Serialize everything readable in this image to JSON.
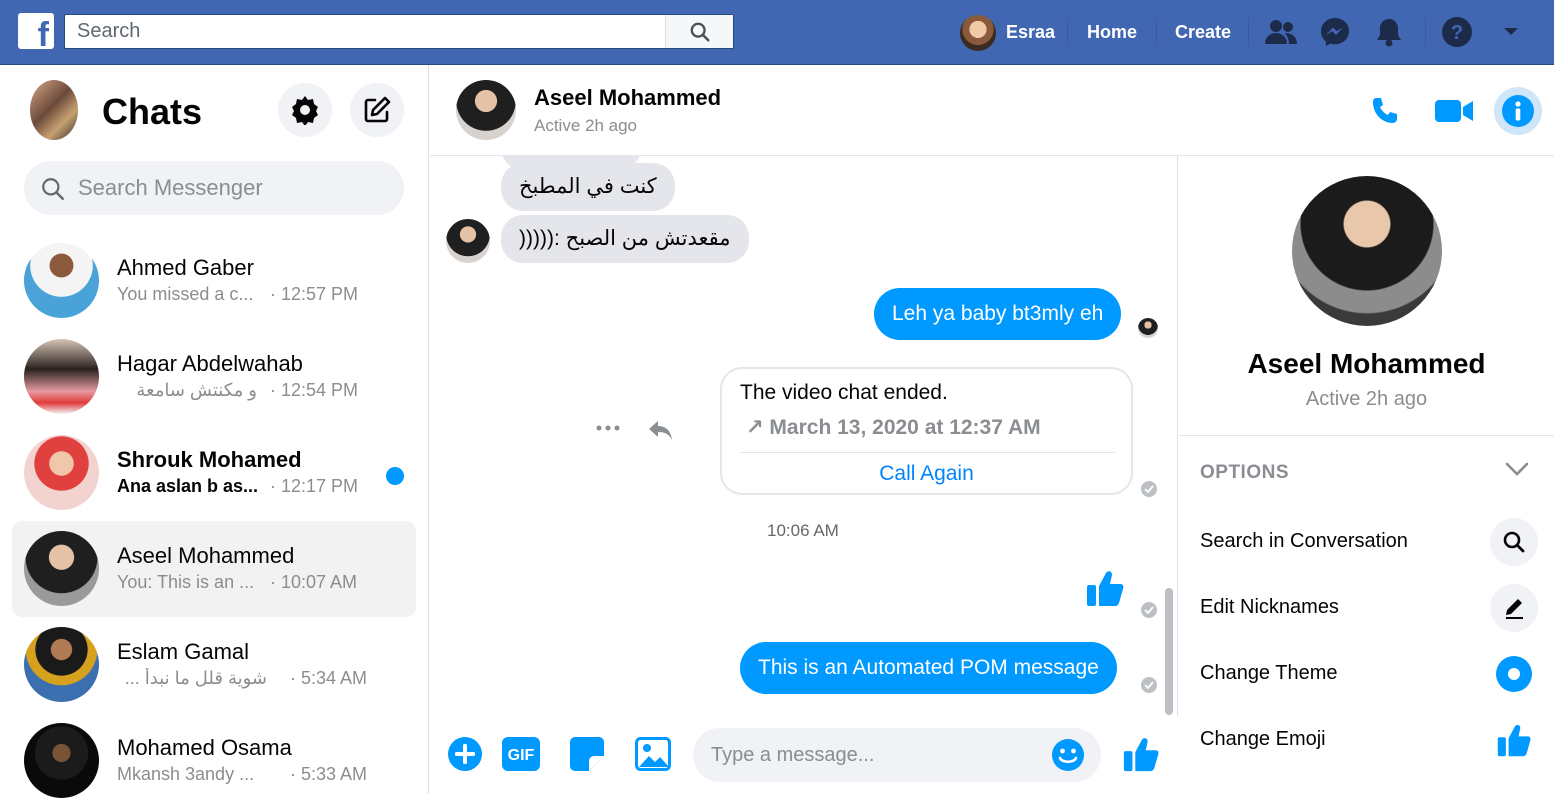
{
  "topbar": {
    "logo_letter": "f",
    "search_placeholder": "Search",
    "user_name": "Esraa",
    "home_label": "Home",
    "create_label": "Create",
    "icons": [
      "friends-icon",
      "messenger-icon",
      "notifications-icon",
      "help-icon",
      "account-menu-icon"
    ],
    "color": "#4267b2"
  },
  "sidebar": {
    "title": "Chats",
    "search_placeholder": "Search Messenger",
    "chats": [
      {
        "name": "Ahmed Gaber",
        "preview": "You missed a c...",
        "time": "· 12:57 PM",
        "unread": false,
        "active": false
      },
      {
        "name": "Hagar Abdelwahab",
        "preview": "و مكنتش سامعة",
        "time": "· 12:54 PM",
        "unread": false,
        "active": false
      },
      {
        "name": "Shrouk Mohamed",
        "preview": "Ana aslan b as...",
        "time": "· 12:17 PM",
        "unread": true,
        "active": false
      },
      {
        "name": "Aseel Mohammed",
        "preview": "You: This is an ...",
        "time": "· 10:07 AM",
        "unread": false,
        "active": true
      },
      {
        "name": "Eslam Gamal",
        "preview": "شوية قلل ما نبدأ ...",
        "time": "· 5:34 AM",
        "unread": false,
        "active": false
      },
      {
        "name": "Mohamed Osama",
        "preview": "Mkansh 3andy ...",
        "time": "· 5:33 AM",
        "unread": false,
        "active": false
      }
    ]
  },
  "conversation": {
    "name": "Aseel Mohammed",
    "status": "Active 2h ago",
    "messages": {
      "in_1": "كنت في المطبخ",
      "in_2": "مقعدتش من الصبح :(((((",
      "out_1": "Leh ya baby bt3mly eh",
      "out_2": "This is an Automated POM message"
    },
    "call_card": {
      "title": "The video chat ended.",
      "date": "↗ March 13, 2020 at 12:37 AM",
      "action": "Call Again"
    },
    "timestamp": "10:06 AM",
    "composer_placeholder": "Type a message...",
    "gif_label": "GIF",
    "accent": "#0099ff"
  },
  "info_panel": {
    "name": "Aseel Mohammed",
    "status": "Active 2h ago",
    "options_label": "OPTIONS",
    "options": [
      {
        "label": "Search in Conversation",
        "icon": "search-icon"
      },
      {
        "label": "Edit Nicknames",
        "icon": "pencil-icon"
      },
      {
        "label": "Change Theme",
        "icon": "theme-icon"
      },
      {
        "label": "Change Emoji",
        "icon": "thumbs-up-icon"
      }
    ]
  }
}
